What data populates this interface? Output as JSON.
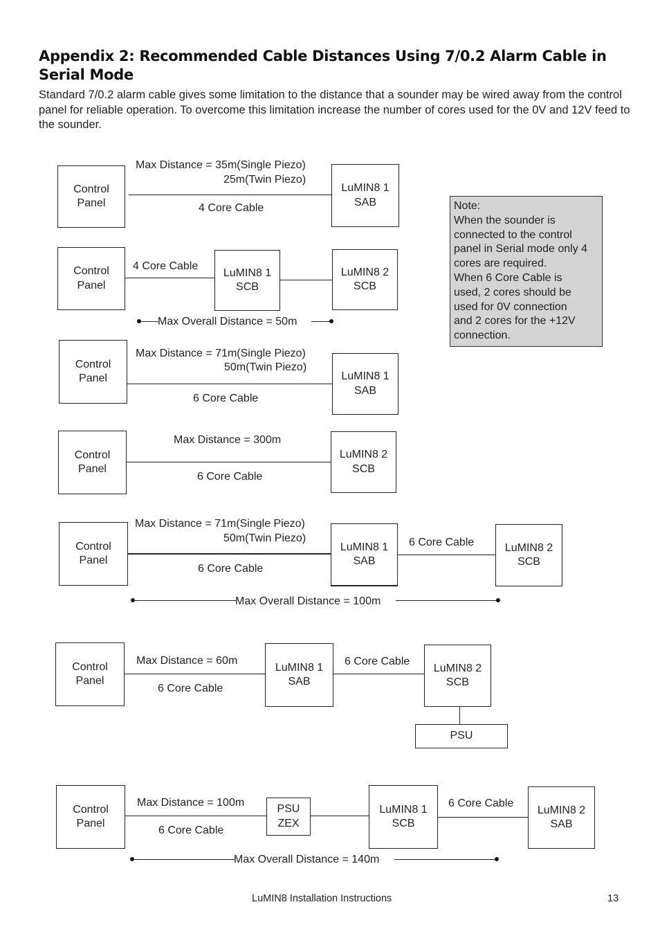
{
  "page": {
    "title": "Appendix 2: Recommended Cable Distances Using 7/0.2 Alarm Cable in Serial Mode",
    "intro": "Standard 7/0.2 alarm cable gives some limitation to the distance that a sounder may be wired away from the control panel for reliable operation. To overcome this limitation increase the number of cores used for the 0V and 12V feed to the sounder."
  },
  "note": {
    "lines": [
      "Note:",
      "When the sounder is",
      "connected to the control",
      "panel in Serial mode only 4",
      "cores are required.",
      "When 6 Core Cable is",
      "used, 2 cores should be",
      "used for 0V connection",
      "and 2 cores for the +12V",
      "connection."
    ]
  },
  "diagrams": [
    {
      "nodes": [
        [
          "Control",
          "Panel"
        ],
        [
          "LuMIN8 1",
          "SAB"
        ]
      ],
      "max_line1": "Max Distance = 35m(Single Piezo)",
      "max_line2": "25m(Twin Piezo)",
      "cable": "4 Core Cable"
    },
    {
      "nodes": [
        [
          "Control",
          "Panel"
        ],
        [
          "LuMIN8 1",
          "SCB"
        ],
        [
          "LuMIN8 2",
          "SCB"
        ]
      ],
      "cable": "4 Core Cable",
      "overall": "Max Overall Distance  = 50m"
    },
    {
      "nodes": [
        [
          "Control",
          "Panel"
        ],
        [
          "LuMIN8 1",
          "SAB"
        ]
      ],
      "max_line1": "Max Distance = 71m(Single Piezo)",
      "max_line2": "50m(Twin Piezo)",
      "cable": "6 Core Cable"
    },
    {
      "nodes": [
        [
          "Control",
          "Panel"
        ],
        [
          "LuMIN8 2",
          "SCB"
        ]
      ],
      "max_line1": "Max Distance = 300m",
      "cable": "6 Core Cable"
    },
    {
      "nodes": [
        [
          "Control",
          "Panel"
        ],
        [
          "LuMIN8 1",
          "SAB"
        ],
        [
          "LuMIN8 2",
          "SCB"
        ]
      ],
      "max_line1": "Max Distance = 71m(Single Piezo)",
      "max_line2": "50m(Twin Piezo)",
      "cable": "6 Core Cable",
      "cable2": "6 Core Cable",
      "overall": "Max Overall Distance  = 100m"
    },
    {
      "nodes": [
        [
          "Control",
          "Panel"
        ],
        [
          "LuMIN8 1",
          "SAB"
        ],
        [
          "LuMIN8 2",
          "SCB"
        ],
        [
          "PSU"
        ]
      ],
      "max_line1": "Max Distance = 60m",
      "cable": "6 Core Cable",
      "cable2": "6 Core Cable"
    },
    {
      "nodes": [
        [
          "Control",
          "Panel"
        ],
        [
          "PSU",
          "ZEX"
        ],
        [
          "LuMIN8 1",
          "SCB"
        ],
        [
          "LuMIN8 2",
          "SAB"
        ]
      ],
      "max_line1": "Max Distance = 100m",
      "cable": "6 Core Cable",
      "cable2": "6 Core Cable",
      "overall": "Max Overall Distance  = 140m"
    }
  ],
  "footer": {
    "doc_title": "LuMIN8 Installation Instructions",
    "page_number": "13"
  }
}
